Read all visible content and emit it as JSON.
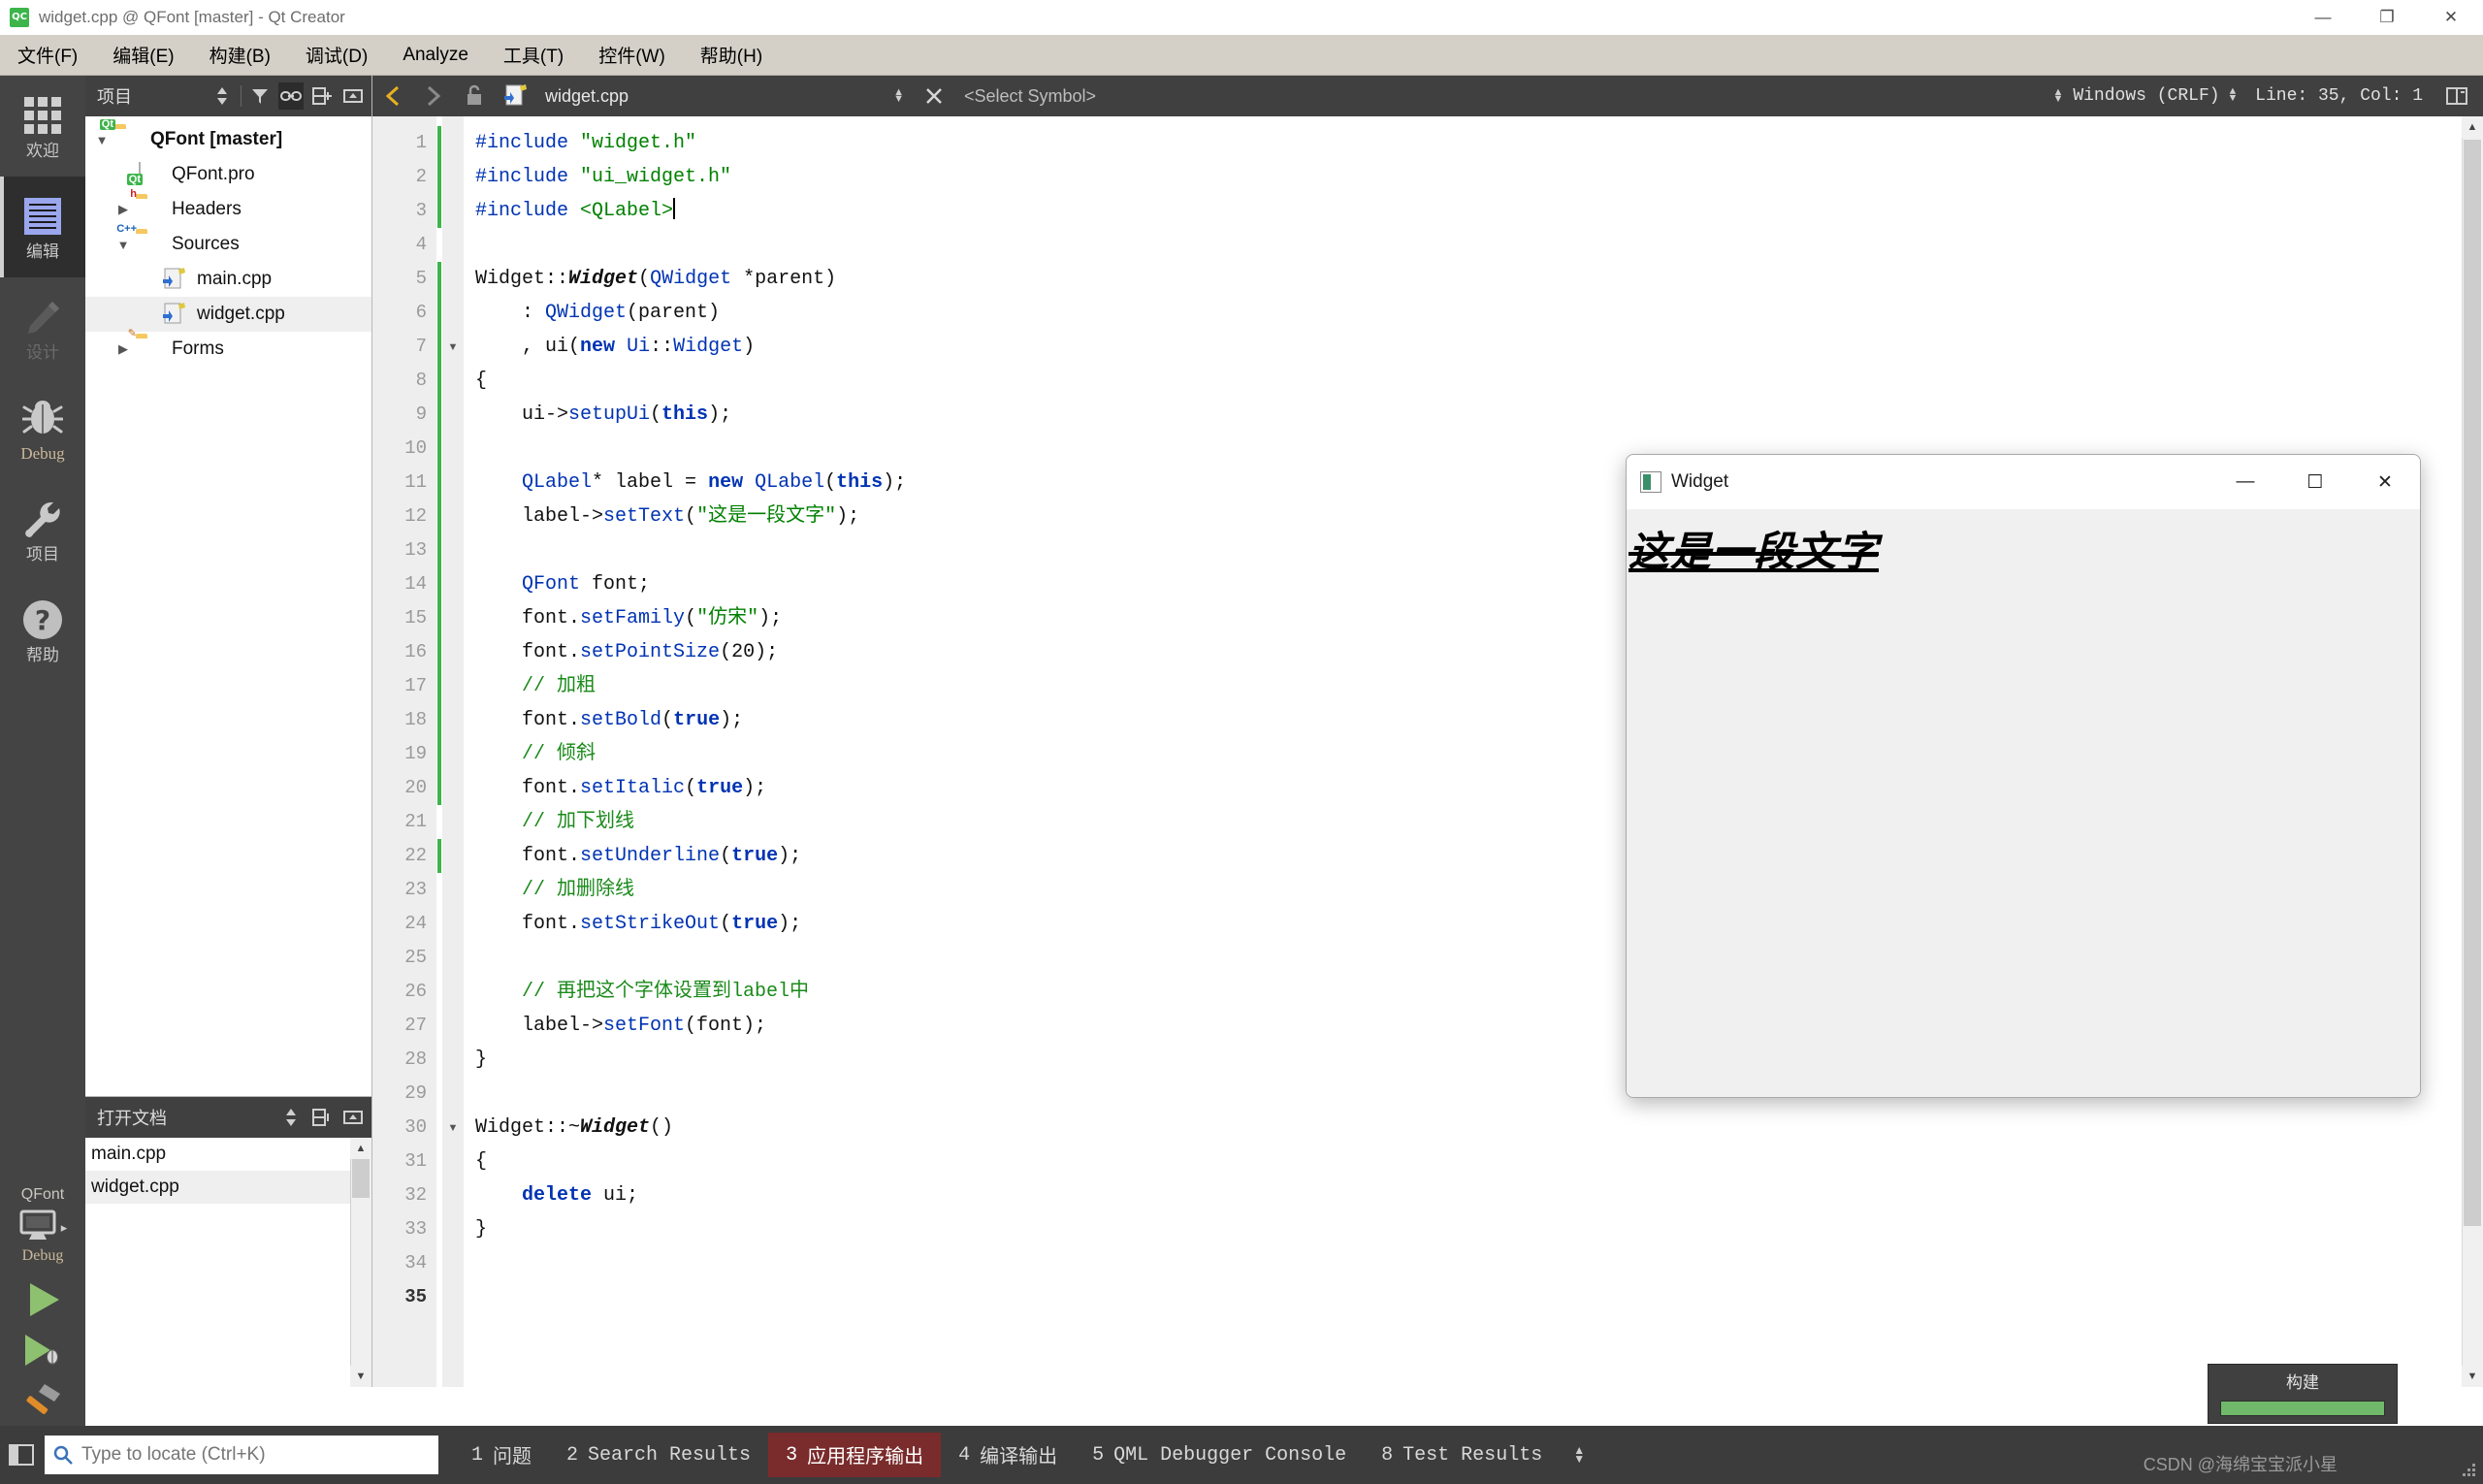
{
  "window": {
    "title": "widget.cpp @ QFont [master] - Qt Creator",
    "app_icon": "qt-creator-icon",
    "minimize": "—",
    "maximize": "❐",
    "close": "✕"
  },
  "menubar": {
    "items": [
      {
        "label": "文件(F)"
      },
      {
        "label": "编辑(E)"
      },
      {
        "label": "构建(B)"
      },
      {
        "label": "调试(D)"
      },
      {
        "label": "Analyze"
      },
      {
        "label": "工具(T)"
      },
      {
        "label": "控件(W)"
      },
      {
        "label": "帮助(H)"
      }
    ]
  },
  "modebar": {
    "items": [
      {
        "label": "欢迎",
        "icon": "grid-icon",
        "state": "normal"
      },
      {
        "label": "编辑",
        "icon": "document-lines-icon",
        "state": "active"
      },
      {
        "label": "设计",
        "icon": "pencil-icon",
        "state": "disabled"
      },
      {
        "label": "Debug",
        "icon": "bug-icon",
        "state": "normal"
      },
      {
        "label": "项目",
        "icon": "wrench-icon",
        "state": "normal"
      },
      {
        "label": "帮助",
        "icon": "question-mark-icon",
        "state": "normal"
      }
    ],
    "kit": {
      "project": "QFont",
      "icon": "monitor-icon",
      "config": "Debug"
    },
    "run_button": "run-triangle-icon",
    "debug_button": "debug-run-icon",
    "build_button": "hammer-icon"
  },
  "project_panel": {
    "title": "项目",
    "header_buttons": [
      "sort-filter-icon",
      "filter-icon",
      "link-icon",
      "split-icon",
      "collapse-icon"
    ],
    "tree": [
      {
        "label": "QFont [master]",
        "icon": "qt-folder-icon",
        "indent": 0,
        "expander": "▼",
        "bold": true,
        "selected": false
      },
      {
        "label": "QFont.pro",
        "icon": "qt-file-icon",
        "indent": 1,
        "expander": "",
        "bold": false,
        "selected": false
      },
      {
        "label": "Headers",
        "icon": "folder-h-icon",
        "indent": 1,
        "expander": "▶",
        "bold": false,
        "selected": false
      },
      {
        "label": "Sources",
        "icon": "folder-cpp-icon",
        "indent": 1,
        "expander": "▼",
        "bold": false,
        "selected": false
      },
      {
        "label": "main.cpp",
        "icon": "cpp-file-icon",
        "indent": 2,
        "expander": "",
        "bold": false,
        "selected": false
      },
      {
        "label": "widget.cpp",
        "icon": "cpp-file-icon",
        "indent": 2,
        "expander": "",
        "bold": false,
        "selected": true
      },
      {
        "label": "Forms",
        "icon": "folder-form-icon",
        "indent": 1,
        "expander": "▶",
        "bold": false,
        "selected": false
      }
    ]
  },
  "open_documents": {
    "title": "打开文档",
    "items": [
      {
        "label": "main.cpp",
        "selected": false
      },
      {
        "label": "widget.cpp",
        "selected": true
      }
    ]
  },
  "editor_toolbar": {
    "back": "◀",
    "forward": "▶",
    "lock_icon": "unlocked-icon",
    "file_icon": "cpp-file-icon",
    "filename": "widget.cpp",
    "symbol_placeholder": "<Select Symbol>",
    "encoding": "Windows (CRLF)",
    "line_col": "Line: 35, Col: 1",
    "split_icon": "split-editor-icon"
  },
  "code": {
    "total_lines": 35,
    "current_line": 35,
    "lines": [
      {
        "n": 1,
        "tokens": [
          {
            "t": "#include ",
            "c": "pre"
          },
          {
            "t": "\"widget.h\"",
            "c": "str"
          }
        ]
      },
      {
        "n": 2,
        "tokens": [
          {
            "t": "#include ",
            "c": "pre"
          },
          {
            "t": "\"ui_widget.h\"",
            "c": "str"
          }
        ]
      },
      {
        "n": 3,
        "tokens": [
          {
            "t": "#include ",
            "c": "pre"
          },
          {
            "t": "<QLabel>",
            "c": "str"
          }
        ]
      },
      {
        "n": 4,
        "tokens": []
      },
      {
        "n": 5,
        "tokens": [
          {
            "t": "Widget",
            "c": "fn"
          },
          {
            "t": "::",
            "c": "fn"
          },
          {
            "t": "Widget",
            "c": "cls"
          },
          {
            "t": "(",
            "c": "fn"
          },
          {
            "t": "QWidget",
            "c": "kw2"
          },
          {
            "t": " *parent)",
            "c": "fn"
          }
        ]
      },
      {
        "n": 6,
        "tokens": [
          {
            "t": "    : ",
            "c": "fn"
          },
          {
            "t": "QWidget",
            "c": "kw2"
          },
          {
            "t": "(parent)",
            "c": "fn"
          }
        ]
      },
      {
        "n": 7,
        "tokens": [
          {
            "t": "    , ui(",
            "c": "fn"
          },
          {
            "t": "new",
            "c": "kw"
          },
          {
            "t": " ",
            "c": "fn"
          },
          {
            "t": "Ui",
            "c": "kw2"
          },
          {
            "t": "::",
            "c": "fn"
          },
          {
            "t": "Widget",
            "c": "kw2"
          },
          {
            "t": ")",
            "c": "fn"
          }
        ]
      },
      {
        "n": 8,
        "tokens": [
          {
            "t": "{",
            "c": "fn"
          }
        ]
      },
      {
        "n": 9,
        "tokens": [
          {
            "t": "    ui->",
            "c": "fn"
          },
          {
            "t": "setupUi",
            "c": "kw2"
          },
          {
            "t": "(",
            "c": "fn"
          },
          {
            "t": "this",
            "c": "kw"
          },
          {
            "t": ");",
            "c": "fn"
          }
        ]
      },
      {
        "n": 10,
        "tokens": []
      },
      {
        "n": 11,
        "tokens": [
          {
            "t": "    ",
            "c": "fn"
          },
          {
            "t": "QLabel",
            "c": "kw2"
          },
          {
            "t": "* label = ",
            "c": "fn"
          },
          {
            "t": "new",
            "c": "kw"
          },
          {
            "t": " ",
            "c": "fn"
          },
          {
            "t": "QLabel",
            "c": "kw2"
          },
          {
            "t": "(",
            "c": "fn"
          },
          {
            "t": "this",
            "c": "kw"
          },
          {
            "t": ");",
            "c": "fn"
          }
        ]
      },
      {
        "n": 12,
        "tokens": [
          {
            "t": "    label->",
            "c": "fn"
          },
          {
            "t": "setText",
            "c": "kw2"
          },
          {
            "t": "(",
            "c": "fn"
          },
          {
            "t": "\"这是一段文字\"",
            "c": "str"
          },
          {
            "t": ");",
            "c": "fn"
          }
        ]
      },
      {
        "n": 13,
        "tokens": []
      },
      {
        "n": 14,
        "tokens": [
          {
            "t": "    ",
            "c": "fn"
          },
          {
            "t": "QFont",
            "c": "kw2"
          },
          {
            "t": " font;",
            "c": "fn"
          }
        ]
      },
      {
        "n": 15,
        "tokens": [
          {
            "t": "    font.",
            "c": "fn"
          },
          {
            "t": "setFamily",
            "c": "kw2"
          },
          {
            "t": "(",
            "c": "fn"
          },
          {
            "t": "\"仿宋\"",
            "c": "str"
          },
          {
            "t": ");",
            "c": "fn"
          }
        ]
      },
      {
        "n": 16,
        "tokens": [
          {
            "t": "    font.",
            "c": "fn"
          },
          {
            "t": "setPointSize",
            "c": "kw2"
          },
          {
            "t": "(",
            "c": "fn"
          },
          {
            "t": "20",
            "c": "num"
          },
          {
            "t": ");",
            "c": "fn"
          }
        ]
      },
      {
        "n": 17,
        "tokens": [
          {
            "t": "    // 加粗",
            "c": "cmt"
          }
        ]
      },
      {
        "n": 18,
        "tokens": [
          {
            "t": "    font.",
            "c": "fn"
          },
          {
            "t": "setBold",
            "c": "kw2"
          },
          {
            "t": "(",
            "c": "fn"
          },
          {
            "t": "true",
            "c": "kw"
          },
          {
            "t": ");",
            "c": "fn"
          }
        ]
      },
      {
        "n": 19,
        "tokens": [
          {
            "t": "    // 倾斜",
            "c": "cmt"
          }
        ]
      },
      {
        "n": 20,
        "tokens": [
          {
            "t": "    font.",
            "c": "fn"
          },
          {
            "t": "setItalic",
            "c": "kw2"
          },
          {
            "t": "(",
            "c": "fn"
          },
          {
            "t": "true",
            "c": "kw"
          },
          {
            "t": ");",
            "c": "fn"
          }
        ]
      },
      {
        "n": 21,
        "tokens": [
          {
            "t": "    // 加下划线",
            "c": "cmt"
          }
        ]
      },
      {
        "n": 22,
        "tokens": [
          {
            "t": "    font.",
            "c": "fn"
          },
          {
            "t": "setUnderline",
            "c": "kw2"
          },
          {
            "t": "(",
            "c": "fn"
          },
          {
            "t": "true",
            "c": "kw"
          },
          {
            "t": ");",
            "c": "fn"
          }
        ]
      },
      {
        "n": 23,
        "tokens": [
          {
            "t": "    // 加删除线",
            "c": "cmt"
          }
        ]
      },
      {
        "n": 24,
        "tokens": [
          {
            "t": "    font.",
            "c": "fn"
          },
          {
            "t": "setStrikeOut",
            "c": "kw2"
          },
          {
            "t": "(",
            "c": "fn"
          },
          {
            "t": "true",
            "c": "kw"
          },
          {
            "t": ");",
            "c": "fn"
          }
        ]
      },
      {
        "n": 25,
        "tokens": []
      },
      {
        "n": 26,
        "tokens": [
          {
            "t": "    // 再把这个字体设置到label中",
            "c": "cmt"
          }
        ]
      },
      {
        "n": 27,
        "tokens": [
          {
            "t": "    label->",
            "c": "fn"
          },
          {
            "t": "setFont",
            "c": "kw2"
          },
          {
            "t": "(font);",
            "c": "fn"
          }
        ]
      },
      {
        "n": 28,
        "tokens": [
          {
            "t": "}",
            "c": "fn"
          }
        ]
      },
      {
        "n": 29,
        "tokens": []
      },
      {
        "n": 30,
        "tokens": [
          {
            "t": "Widget",
            "c": "fn"
          },
          {
            "t": "::~",
            "c": "fn"
          },
          {
            "t": "Widget",
            "c": "cls"
          },
          {
            "t": "()",
            "c": "fn"
          }
        ]
      },
      {
        "n": 31,
        "tokens": [
          {
            "t": "{",
            "c": "fn"
          }
        ]
      },
      {
        "n": 32,
        "tokens": [
          {
            "t": "    ",
            "c": "fn"
          },
          {
            "t": "delete",
            "c": "kw"
          },
          {
            "t": " ui;",
            "c": "fn"
          }
        ]
      },
      {
        "n": 33,
        "tokens": [
          {
            "t": "}",
            "c": "fn"
          }
        ]
      },
      {
        "n": 34,
        "tokens": []
      },
      {
        "n": 35,
        "tokens": []
      }
    ]
  },
  "widget_window": {
    "title": "Widget",
    "icon": "widget-icon",
    "minimize": "—",
    "maximize": "☐",
    "close": "✕",
    "label_text": "这是一段文字"
  },
  "build_popup": {
    "title": "构建",
    "progress_percent": 100
  },
  "statusbar": {
    "sidebar_toggle": "panel-toggle-icon",
    "search_icon": "search-icon",
    "locator_placeholder": "Type to locate (Ctrl+K)",
    "locator_value": "",
    "panes": [
      {
        "num": "1",
        "label": "问题",
        "active": false
      },
      {
        "num": "2",
        "label": "Search Results",
        "active": false
      },
      {
        "num": "3",
        "label": "应用程序输出",
        "active": true
      },
      {
        "num": "4",
        "label": "编译输出",
        "active": false
      },
      {
        "num": "5",
        "label": "QML Debugger Console",
        "active": false
      },
      {
        "num": "8",
        "label": "Test Results",
        "active": false
      }
    ],
    "watermark": "CSDN @海绵宝宝派小星"
  },
  "colors": {
    "accent_blue": "#9aa7ee",
    "sidebar_bg": "#444444",
    "menubar_bg": "#d4d0c8",
    "toolbar_bg": "#404040",
    "status_active": "#7a2b2b",
    "string_green": "#008000",
    "keyword_blue": "#0033b3",
    "comment_green": "#1a8a1a",
    "progress_green": "#70b96b"
  }
}
